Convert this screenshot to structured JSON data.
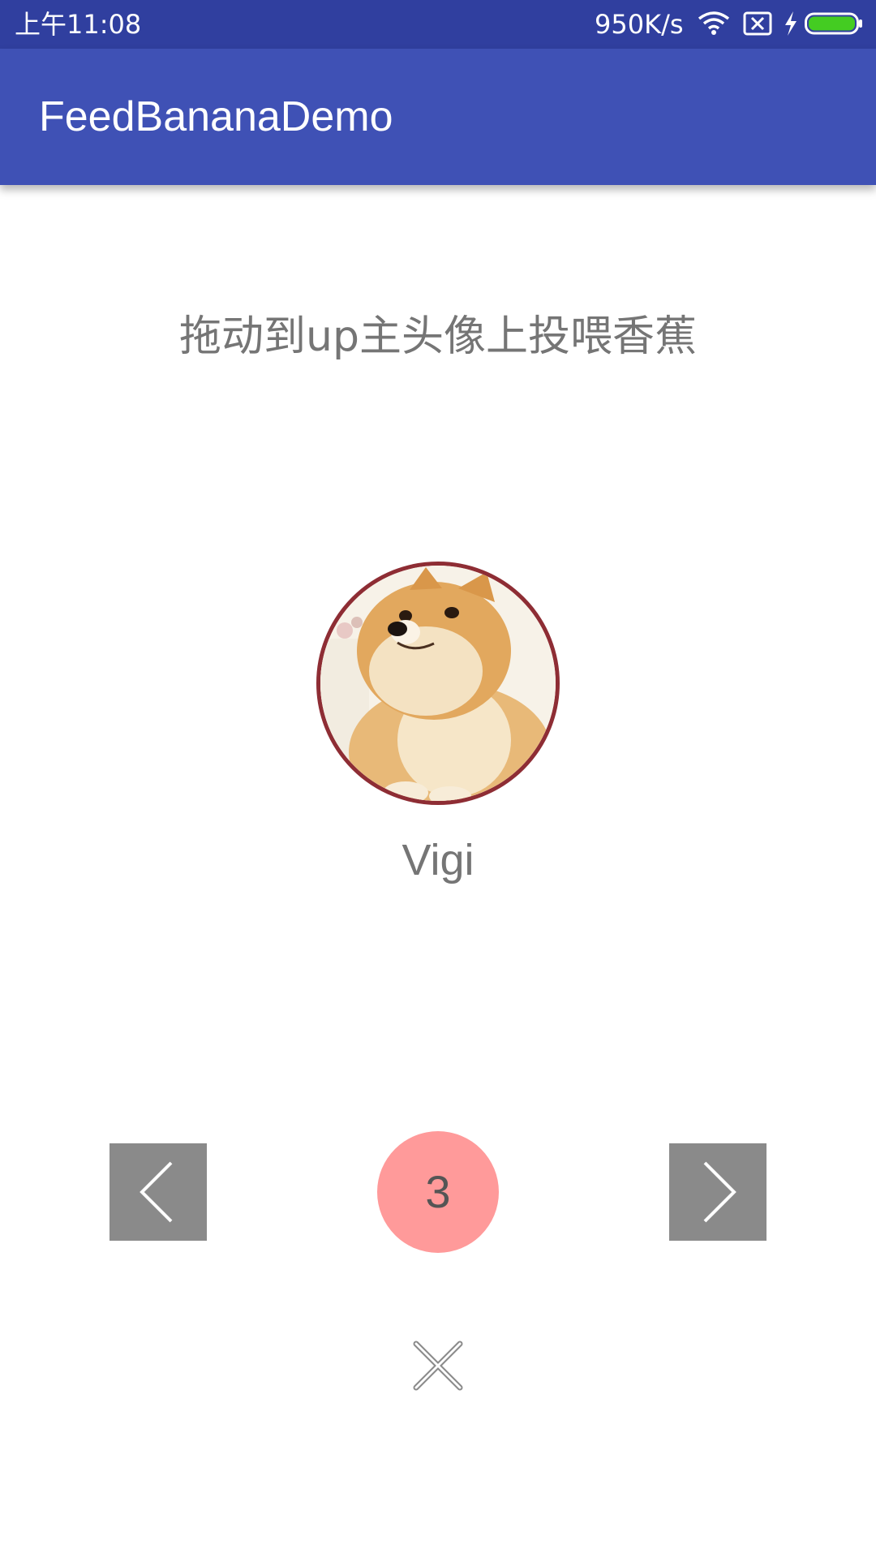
{
  "status_bar": {
    "time": "上午11:08",
    "net_speed": "950K/s",
    "icons": [
      "wifi-icon",
      "sim-off-icon",
      "charging-bolt-icon",
      "battery-icon"
    ],
    "battery_color": "#44CC22"
  },
  "app_bar": {
    "title": "FeedBananaDemo",
    "color": "#3F51B5"
  },
  "main": {
    "hint": "拖动到up主头像上投喂香蕉",
    "avatar": {
      "image": "shiba-inu-dog-photo",
      "border_color": "#8E2D34"
    },
    "username": "Vigi"
  },
  "controls": {
    "prev_icon": "chevron-left-icon",
    "next_icon": "chevron-right-icon",
    "banana_count": "3",
    "badge_color": "#FF9A9A",
    "close_icon": "close-icon"
  }
}
